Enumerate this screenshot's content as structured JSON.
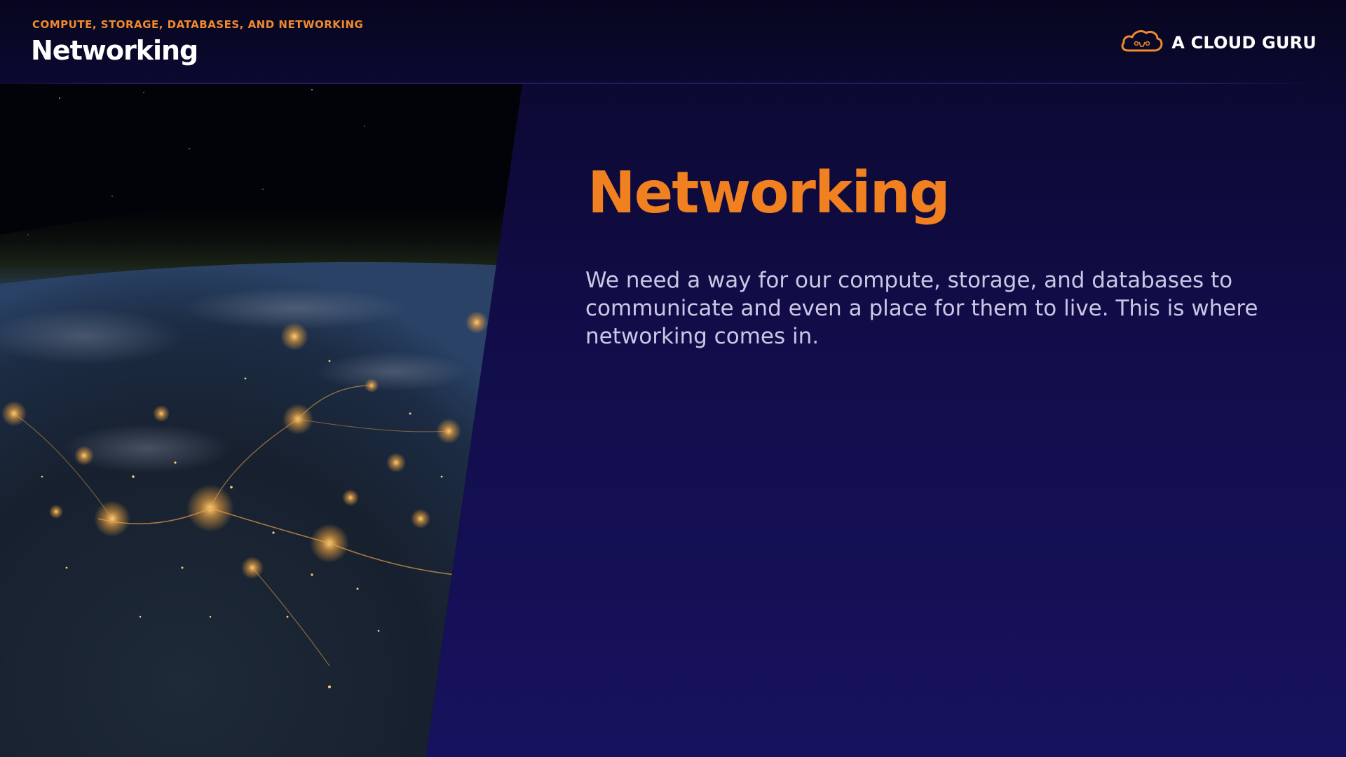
{
  "header": {
    "eyebrow": "COMPUTE, STORAGE, DATABASES, AND NETWORKING",
    "title": "Networking"
  },
  "brand": {
    "name": "A CLOUD GURU",
    "icon": "cloud-logo-icon"
  },
  "main": {
    "title": "Networking",
    "body": "We need a way for our compute, storage, and databases to communicate and even a place for them to live. This is where networking comes in."
  },
  "image": {
    "subject": "earth-at-night-photo"
  },
  "colors": {
    "accent": "#f08020",
    "background": "#120d4a",
    "header_text": "#ffffff",
    "body_text": "#c9c7e4"
  }
}
